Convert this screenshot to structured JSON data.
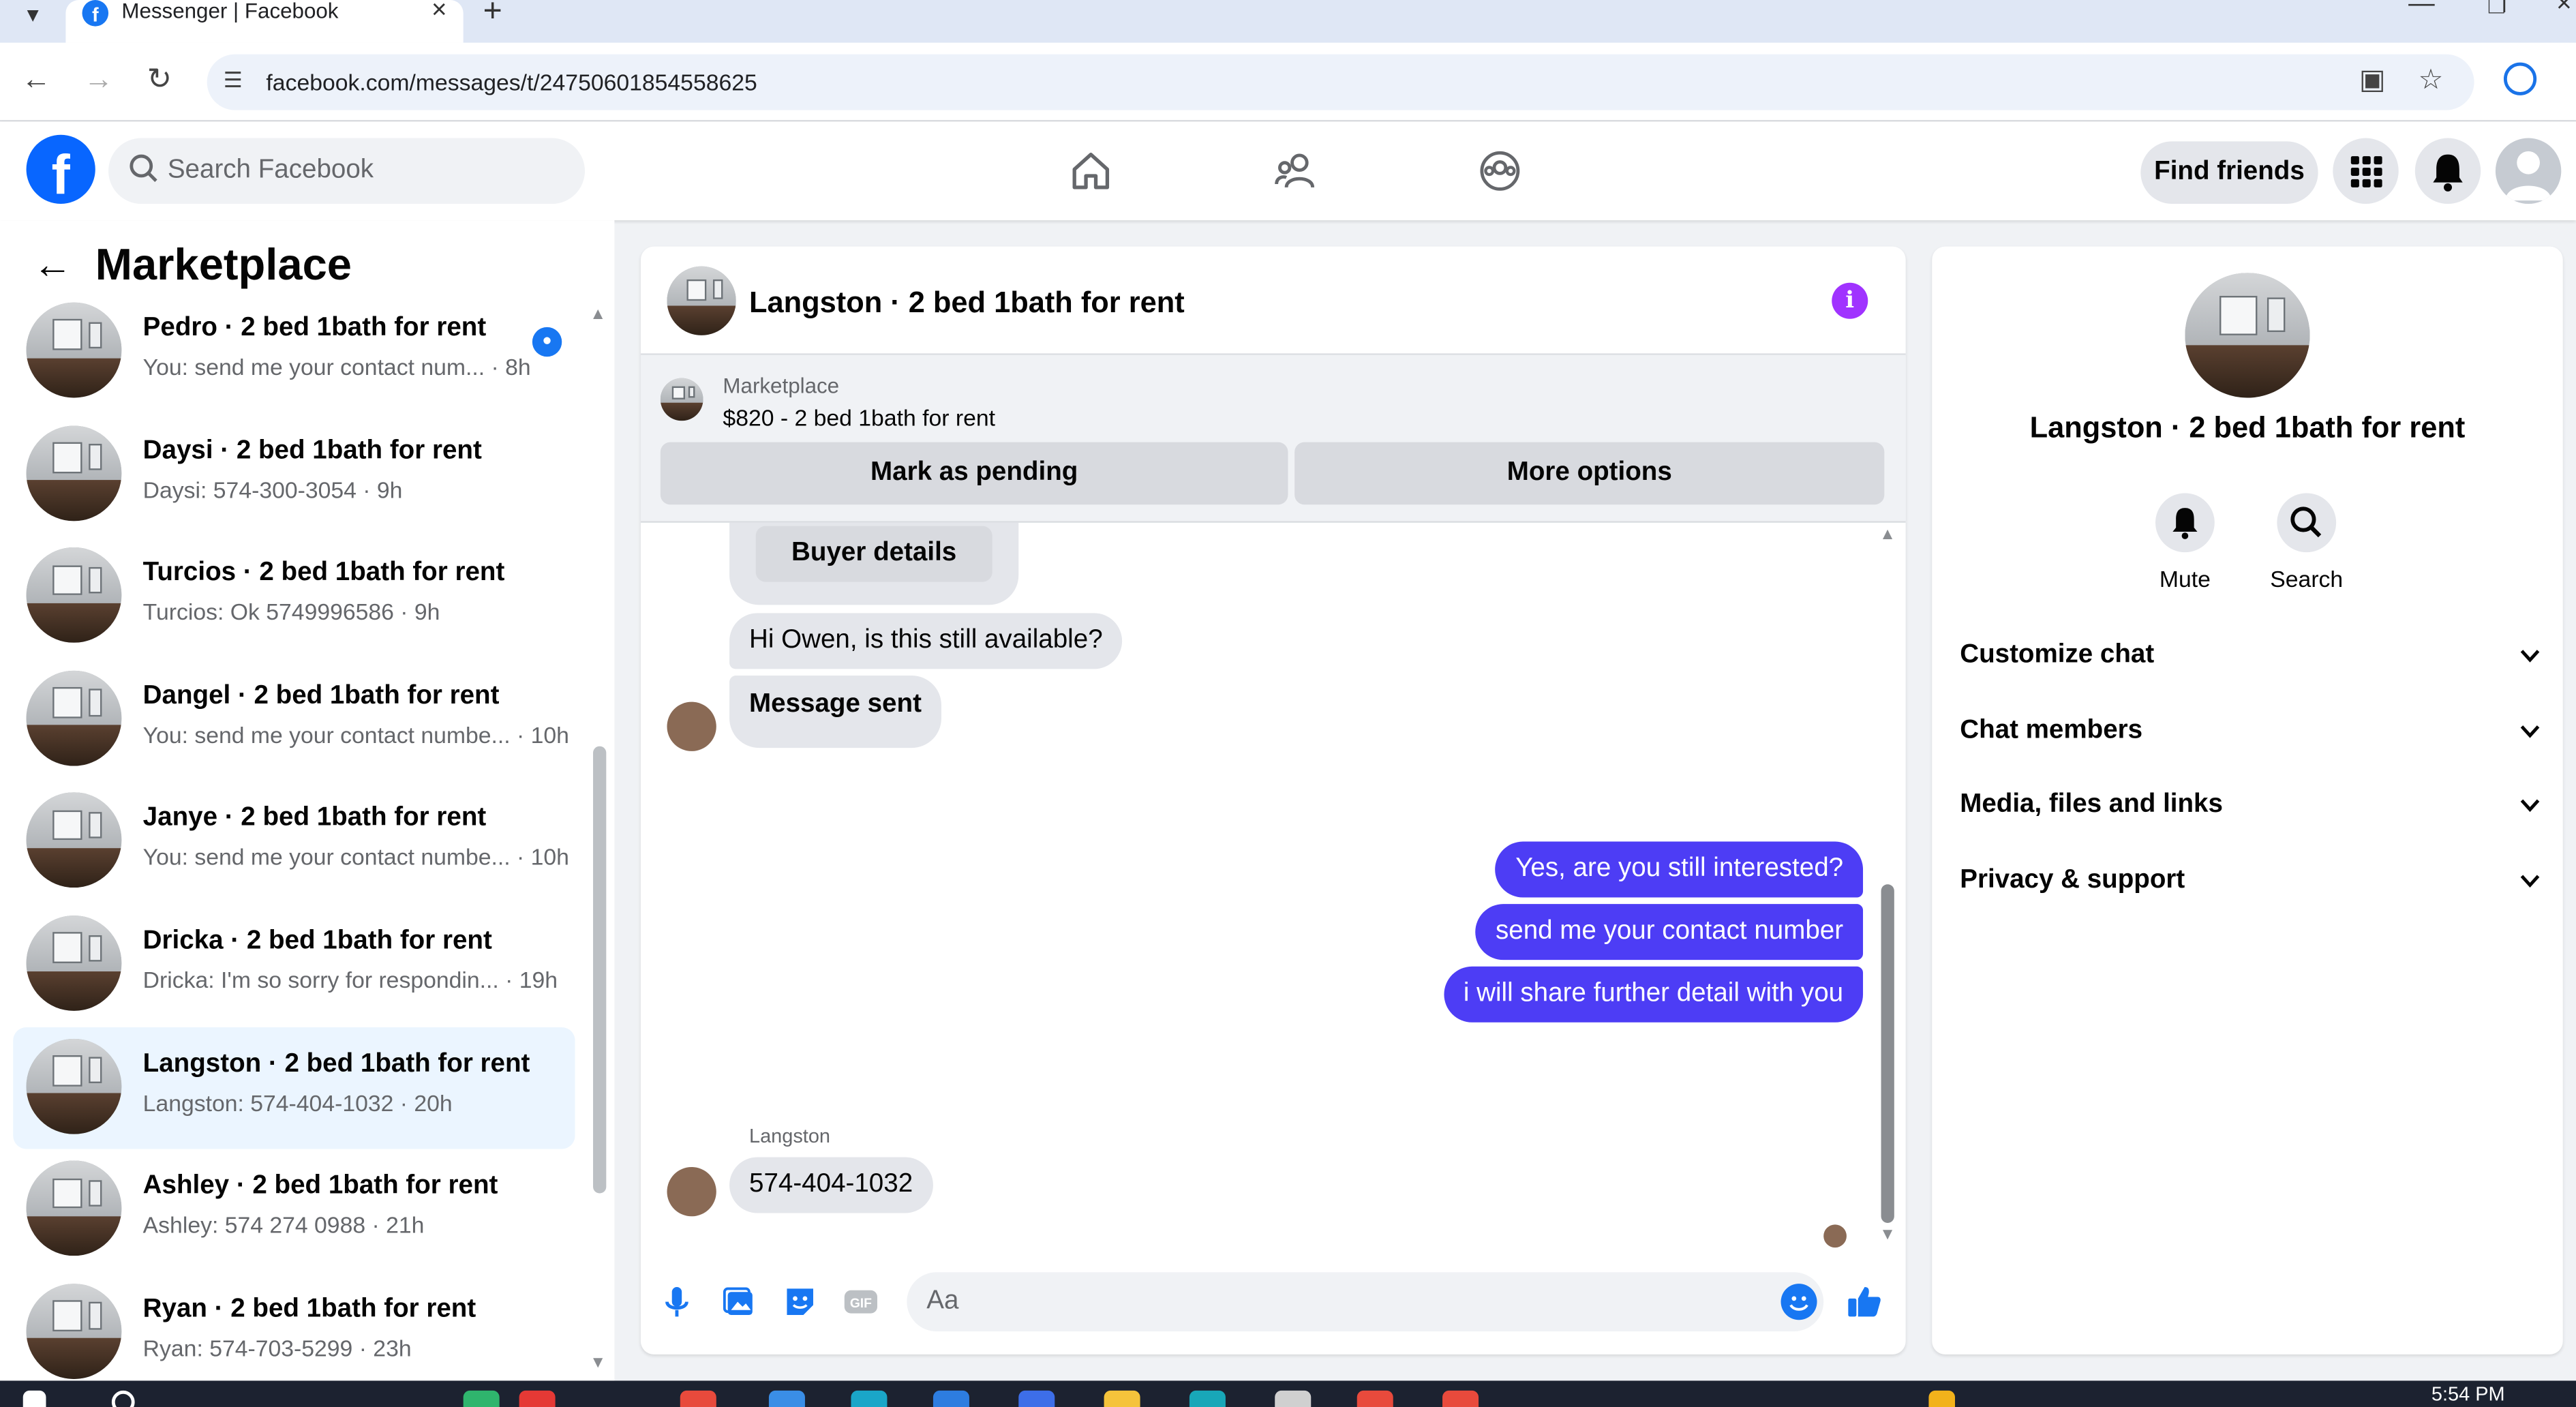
{
  "browser": {
    "tab_title": "Messenger | Facebook",
    "url": "facebook.com/messages/t/24750601854558625"
  },
  "fbnav": {
    "search_placeholder": "Search Facebook",
    "find_friends_label": "Find friends"
  },
  "left_panel": {
    "title": "Marketplace",
    "conversations": [
      {
        "name": "Pedro · 2 bed 1bath for rent",
        "preview": "You: send me your contact num... · 8h",
        "active": false
      },
      {
        "name": "Daysi · 2 bed 1bath for rent",
        "preview": "Daysi: 574-300-3054 · 9h",
        "active": false
      },
      {
        "name": "Turcios · 2 bed 1bath for rent",
        "preview": "Turcios: Ok 5749996586 · 9h",
        "active": false
      },
      {
        "name": "Dangel · 2 bed 1bath for rent",
        "preview": "You: send me your contact numbe... · 10h",
        "active": false
      },
      {
        "name": "Janye · 2 bed 1bath for rent",
        "preview": "You: send me your contact numbe... · 10h",
        "active": false
      },
      {
        "name": "Dricka · 2 bed 1bath for rent",
        "preview": "Dricka: I'm so sorry for respondin... · 19h",
        "active": false
      },
      {
        "name": "Langston · 2 bed 1bath for rent",
        "preview": "Langston: 574-404-1032 · 20h",
        "active": true
      },
      {
        "name": "Ashley · 2 bed 1bath for rent",
        "preview": "Ashley: 574 274 0988 · 21h",
        "active": false
      },
      {
        "name": "Ryan · 2 bed 1bath for rent",
        "preview": "Ryan: 574-703-5299 · 23h",
        "active": false
      }
    ]
  },
  "chat": {
    "title": "Langston · 2 bed 1bath for rent",
    "listing_label": "Marketplace",
    "listing_price": "$820 - 2 bed 1bath for rent",
    "mark_pending_label": "Mark as pending",
    "more_options_label": "More options",
    "buyer_details_label": "Buyer details",
    "incoming_1": "Hi Owen, is this still available?",
    "incoming_2": "Message sent",
    "outgoing_1": "Yes, are you still interested?",
    "outgoing_2": "send me your contact number",
    "outgoing_3": "i will share further detail with you",
    "sender_label": "Langston",
    "incoming_3": "574-404-1032",
    "composer_placeholder": "Aa"
  },
  "right_panel": {
    "name": "Langston · 2 bed 1bath for rent",
    "mute_label": "Mute",
    "search_label": "Search",
    "sections": [
      "Customize chat",
      "Chat members",
      "Media, files and links",
      "Privacy & support"
    ]
  },
  "taskbar": {
    "clock": "5:54 PM"
  },
  "colors": {
    "accent_blue": "#1877f2",
    "outgoing_bubble": "#4d3df5",
    "info_purple": "#a033ff"
  }
}
